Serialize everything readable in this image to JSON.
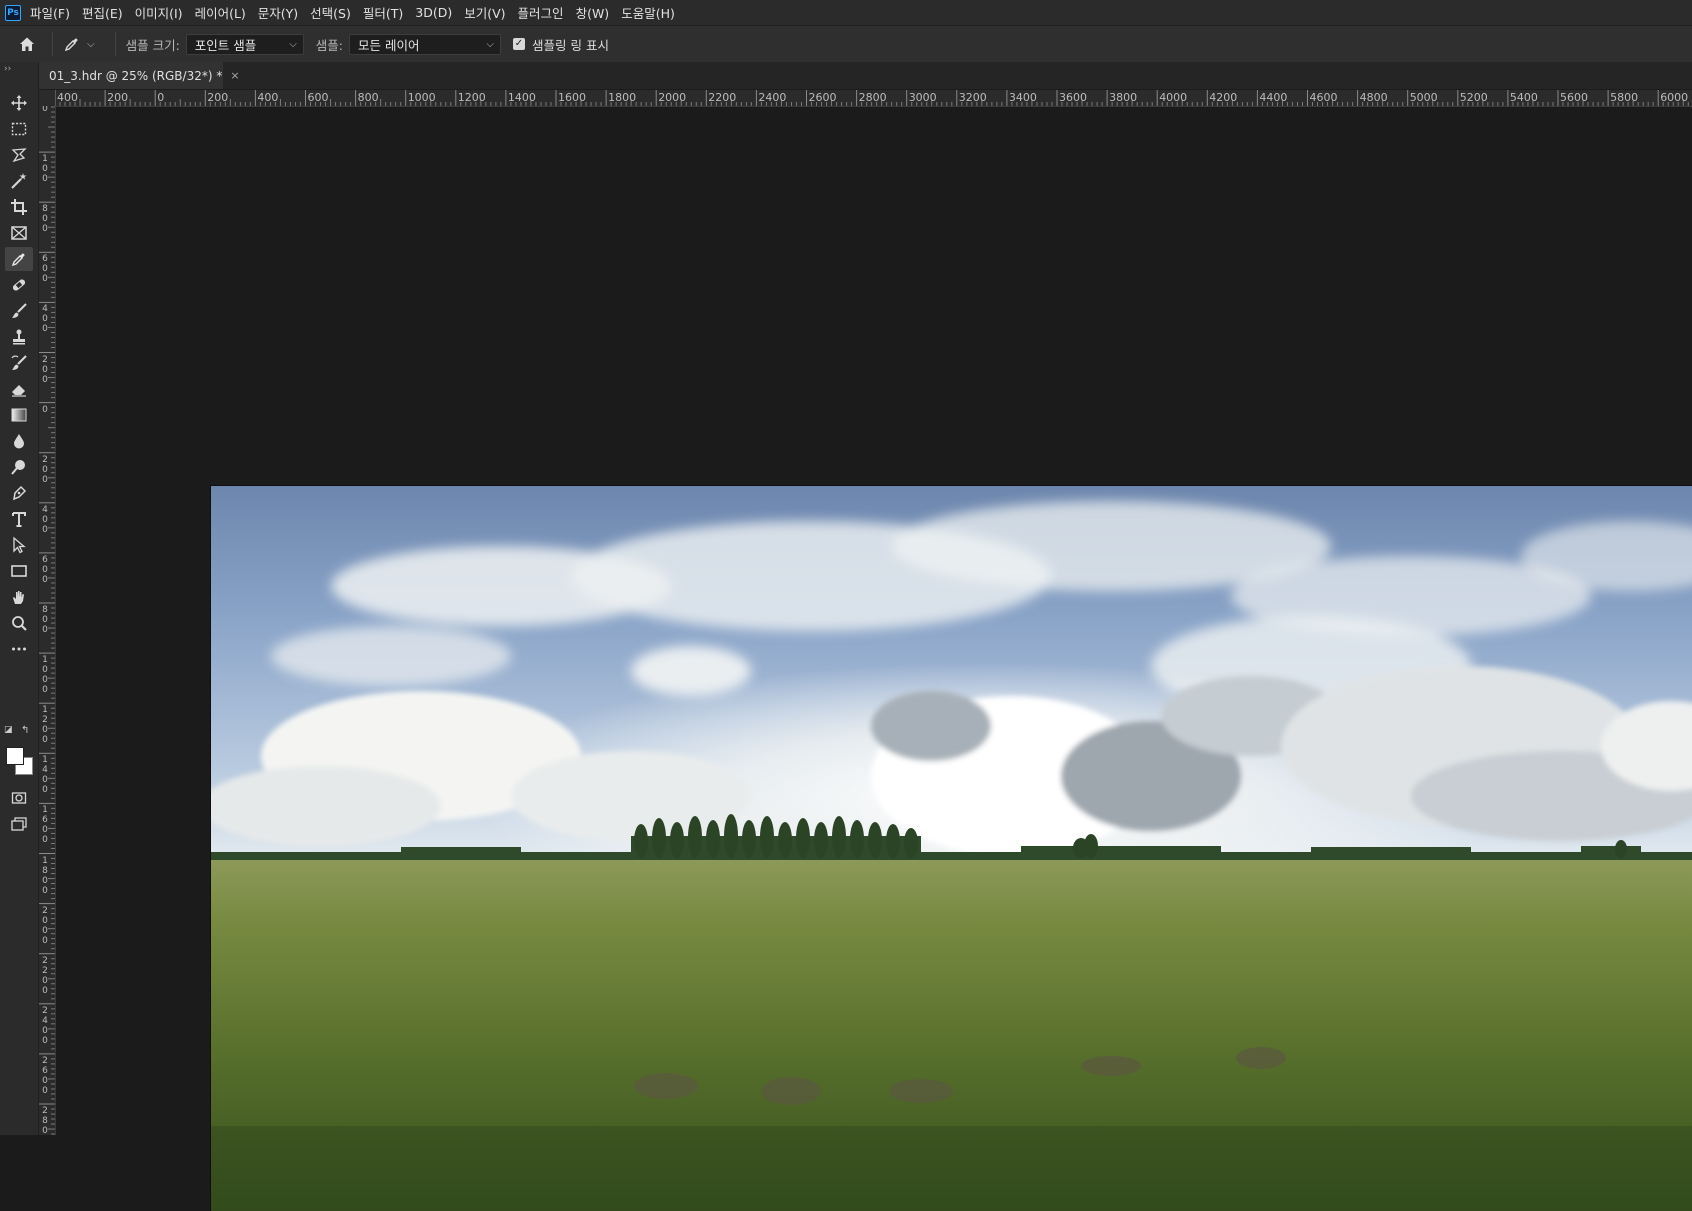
{
  "app": {
    "logo": "Ps"
  },
  "menu": [
    "파일(F)",
    "편집(E)",
    "이미지(I)",
    "레이어(L)",
    "문자(Y)",
    "선택(S)",
    "필터(T)",
    "3D(D)",
    "보기(V)",
    "플러그인",
    "창(W)",
    "도움말(H)"
  ],
  "options": {
    "sample_size_label": "샘플 크기:",
    "sample_size_value": "포인트 샘플",
    "sample_label": "샘플:",
    "sample_value": "모든 레이어",
    "show_ring_label": "샘플링 링 표시",
    "show_ring_checked": true
  },
  "document": {
    "tab_title": "01_3.hdr @ 25% (RGB/32*) *",
    "close_symbol": "×"
  },
  "rulers": {
    "horizontal": [
      "400",
      "200",
      "0",
      "200",
      "400",
      "600",
      "800",
      "1000",
      "1200",
      "1400",
      "1600",
      "1800",
      "2000",
      "2200",
      "2400",
      "2600",
      "2800",
      "3000",
      "3200",
      "3400",
      "3600",
      "3800",
      "4000",
      "4200",
      "4400",
      "4600",
      "4800",
      "5000",
      "5200",
      "5400",
      "5600",
      "5800",
      "6000"
    ],
    "vertical": [
      "0",
      "100",
      "800",
      "600",
      "400",
      "200",
      "0",
      "200",
      "400",
      "600",
      "800",
      "1000",
      "1200",
      "1400",
      "1600",
      "1800",
      "2000",
      "2200",
      "2400",
      "2600",
      "2800"
    ]
  },
  "tools": [
    {
      "name": "move-tool",
      "icon": "move-icon"
    },
    {
      "name": "marquee-tool",
      "icon": "marquee-icon"
    },
    {
      "name": "lasso-tool",
      "icon": "lasso-icon"
    },
    {
      "name": "magic-wand-tool",
      "icon": "magic-wand-icon"
    },
    {
      "name": "crop-tool",
      "icon": "crop-icon"
    },
    {
      "name": "frame-tool",
      "icon": "frame-icon"
    },
    {
      "name": "eyedropper-tool",
      "icon": "eyedropper-icon",
      "active": true
    },
    {
      "name": "healing-brush-tool",
      "icon": "bandage-icon"
    },
    {
      "name": "brush-tool",
      "icon": "brush-icon"
    },
    {
      "name": "clone-stamp-tool",
      "icon": "stamp-icon"
    },
    {
      "name": "history-brush-tool",
      "icon": "history-brush-icon"
    },
    {
      "name": "eraser-tool",
      "icon": "eraser-icon"
    },
    {
      "name": "gradient-tool",
      "icon": "gradient-icon"
    },
    {
      "name": "blur-tool",
      "icon": "drop-icon"
    },
    {
      "name": "dodge-tool",
      "icon": "dodge-icon"
    },
    {
      "name": "pen-tool",
      "icon": "pen-icon"
    },
    {
      "name": "type-tool",
      "icon": "type-icon"
    },
    {
      "name": "path-selection-tool",
      "icon": "arrow-icon"
    },
    {
      "name": "rectangle-tool",
      "icon": "rectangle-icon"
    },
    {
      "name": "hand-tool",
      "icon": "hand-icon"
    },
    {
      "name": "zoom-tool",
      "icon": "zoom-icon"
    },
    {
      "name": "edit-toolbar",
      "icon": "more-icon"
    },
    {
      "name": "quick-mask",
      "icon": "quick-mask-icon"
    },
    {
      "name": "screen-mode",
      "icon": "screen-mode-icon"
    }
  ],
  "colors": {
    "foreground": "#ffffff",
    "background": "#ffffff",
    "accent": "#31a8ff"
  }
}
